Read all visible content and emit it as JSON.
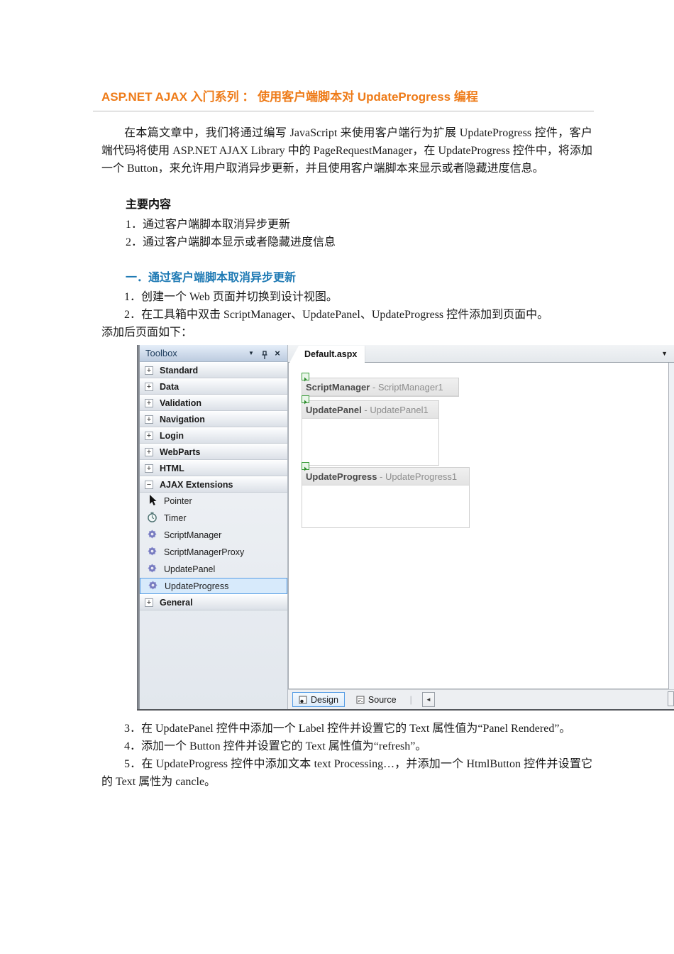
{
  "document": {
    "title": "ASP.NET AJAX 入门系列 ： 使用客户端脚本对 UpdateProgress 编程",
    "intro": "在本篇文章中，我们将通过编写 JavaScript 来使用客户端行为扩展 UpdateProgress 控件，客户端代码将使用 ASP.NET AJAX Library 中的 PageRequestManager，在 UpdateProgress 控件中，将添加一个 Button，来允许用户取消异步更新，并且使用客户端脚本来显示或者隐藏进度信息。",
    "toc_heading": "主要内容",
    "toc_items": [
      "1．通过客户端脚本取消异步更新",
      "2．通过客户端脚本显示或者隐藏进度信息"
    ],
    "section_heading": "一．通过客户端脚本取消异步更新",
    "step1": "1．创建一个 Web 页面并切换到设计视图。",
    "step2": "2．在工具箱中双击 ScriptManager、UpdatePanel、UpdateProgress 控件添加到页面中。",
    "caption": "添加后页面如下：",
    "step3": "3．在 UpdatePanel 控件中添加一个 Label 控件并设置它的 Text 属性值为“Panel Rendered”。",
    "step4": "4．添加一个 Button 控件并设置它的 Text 属性值为“refresh”。",
    "step5": "5．在 UpdateProgress 控件中添加文本 text Processing…，并添加一个 HtmlButton 控件并设置它的 Text 属性为 cancle。"
  },
  "vs": {
    "toolbox": {
      "title": "Toolbox",
      "categories": [
        "Standard",
        "Data",
        "Validation",
        "Navigation",
        "Login",
        "WebParts",
        "HTML"
      ],
      "ajax_category": "AJAX Extensions",
      "items": [
        "Pointer",
        "Timer",
        "ScriptManager",
        "ScriptManagerProxy",
        "UpdatePanel",
        "UpdateProgress"
      ],
      "selected_item": "UpdateProgress",
      "general_category": "General"
    },
    "designer": {
      "tab": "Default.aspx",
      "controls": [
        {
          "type": "ScriptManager",
          "id": "- ScriptManager1"
        },
        {
          "type": "UpdatePanel",
          "id": "- UpdatePanel1"
        },
        {
          "type": "UpdateProgress",
          "id": "- UpdateProgress1"
        }
      ],
      "design_view": "Design",
      "source_view": "Source"
    }
  },
  "icons": {
    "window_dropdown": "▼",
    "close": "×",
    "expand": "+",
    "collapse": "−",
    "tab_dropdown": "▼",
    "back_arrow": "◄",
    "separator": "|"
  },
  "colors": {
    "title_orange": "#ee7b18",
    "heading_blue": "#1f7ab4",
    "selection_border": "#569de5"
  }
}
